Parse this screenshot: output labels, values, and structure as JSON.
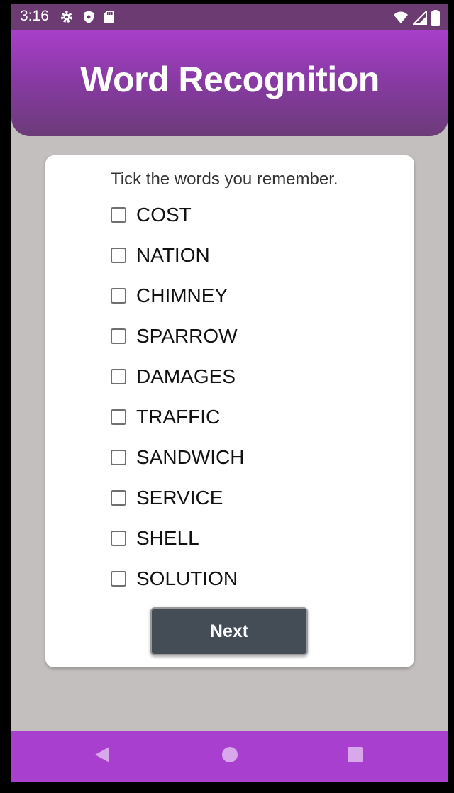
{
  "status_bar": {
    "time": "3:16",
    "left_icons": [
      "settings-icon",
      "shield-icon",
      "sd-card-icon"
    ],
    "right_icons": [
      "wifi-icon",
      "signal-icon",
      "battery-icon"
    ]
  },
  "header": {
    "title": "Word Recognition"
  },
  "card": {
    "instruction": "Tick the words you remember.",
    "words": [
      {
        "label": "COST",
        "checked": false
      },
      {
        "label": "NATION",
        "checked": false
      },
      {
        "label": "CHIMNEY",
        "checked": false
      },
      {
        "label": "SPARROW",
        "checked": false
      },
      {
        "label": "DAMAGES",
        "checked": false
      },
      {
        "label": "TRAFFIC",
        "checked": false
      },
      {
        "label": "SANDWICH",
        "checked": false
      },
      {
        "label": "SERVICE",
        "checked": false
      },
      {
        "label": "SHELL",
        "checked": false
      },
      {
        "label": "SOLUTION",
        "checked": false
      }
    ],
    "next_label": "Next"
  },
  "nav_bar": {
    "buttons": [
      "back-icon",
      "home-icon",
      "recents-icon"
    ]
  },
  "colors": {
    "status_bar": "#6b3b72",
    "header_top": "#a83fca",
    "header_bottom": "#6b3b78",
    "background": "#c4bfbf",
    "button": "#444c55",
    "nav_bar": "#a83fcf"
  }
}
